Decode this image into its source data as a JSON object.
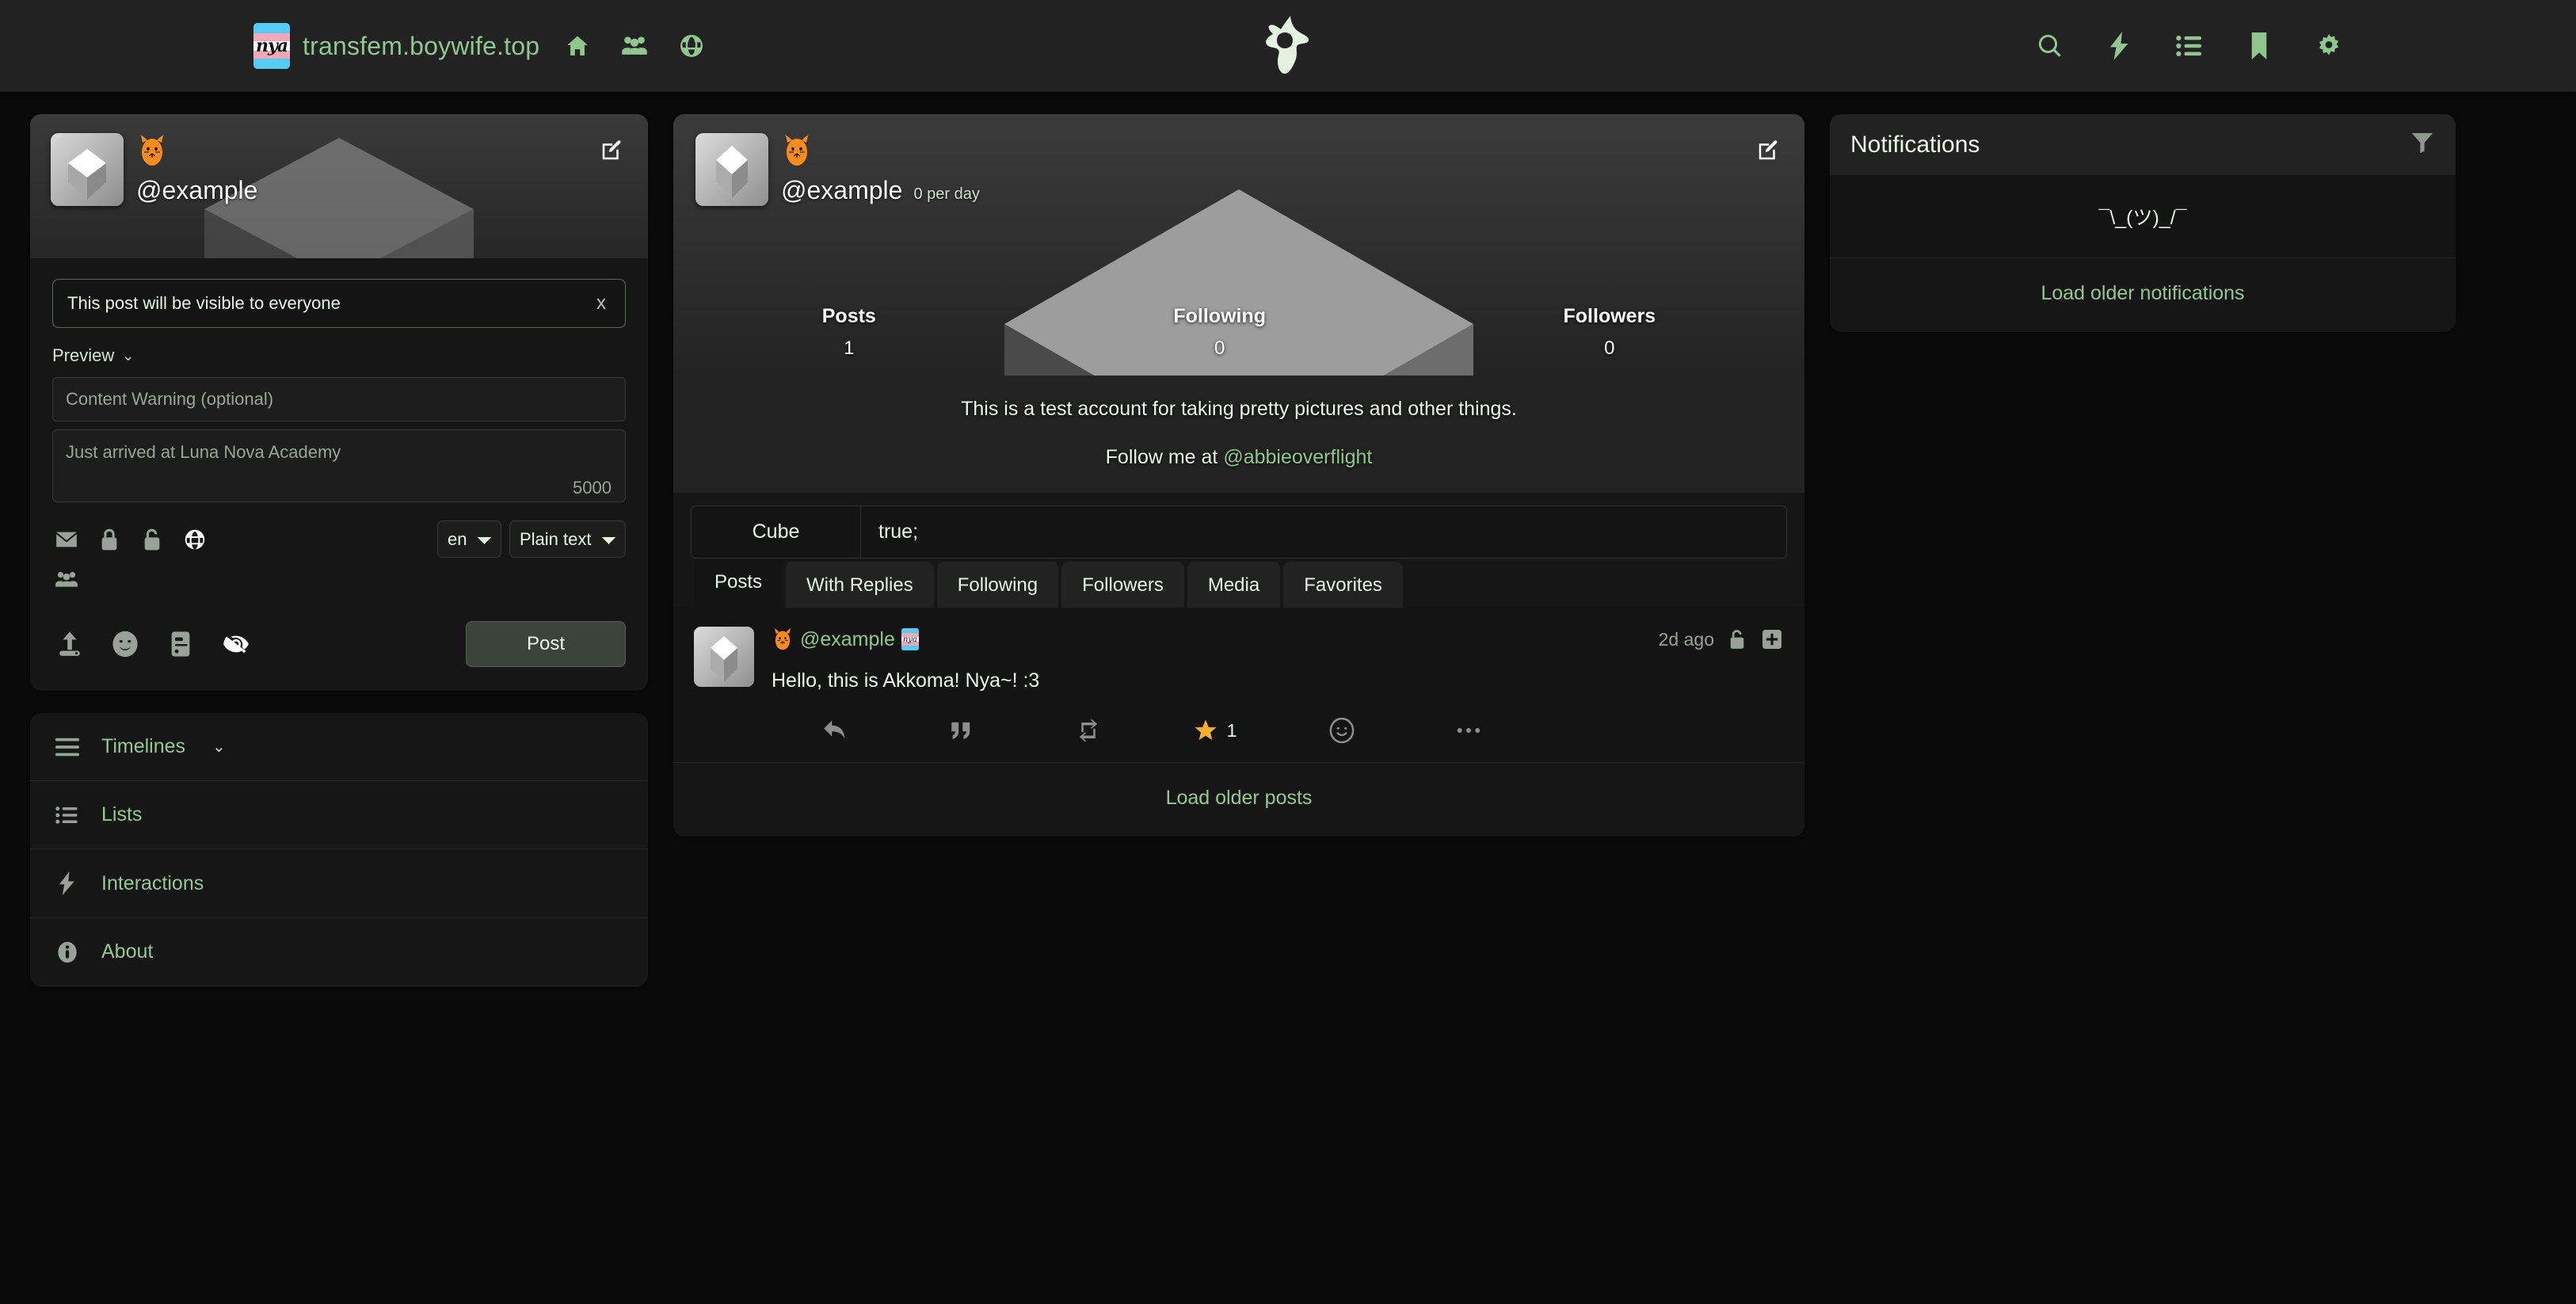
{
  "topbar": {
    "site_name": "transfem.boywife.top",
    "logo_text": "nya",
    "left_icons": [
      {
        "name": "home-icon",
        "label": "Home"
      },
      {
        "name": "users-icon",
        "label": "Local timeline"
      },
      {
        "name": "globe-icon",
        "label": "Federated timeline"
      }
    ],
    "right_icons": [
      {
        "name": "search-icon",
        "label": "Search"
      },
      {
        "name": "bolt-icon",
        "label": "Interactions"
      },
      {
        "name": "list-icon",
        "label": "Lists"
      },
      {
        "name": "bookmark-icon",
        "label": "Bookmarks"
      },
      {
        "name": "gear-icon",
        "label": "Settings"
      }
    ],
    "center_logo": "akkoma-logo"
  },
  "user_panel": {
    "handle": "@example",
    "emoji": "fox-emoji",
    "edit_label": "Edit profile"
  },
  "compose": {
    "visibility_alert": "This post will be visible to everyone",
    "close_label": "x",
    "preview_label": "Preview",
    "cw_placeholder": "Content Warning (optional)",
    "cw_value": "",
    "body_placeholder": "Just arrived at Luna Nova Academy",
    "body_value": "",
    "char_count": "5000",
    "visibility_icons": [
      {
        "name": "envelope-icon",
        "label": "Direct",
        "active": false
      },
      {
        "name": "lock-icon",
        "label": "Followers only",
        "active": false
      },
      {
        "name": "unlock-icon",
        "label": "Unlisted",
        "active": false
      },
      {
        "name": "globe-icon",
        "label": "Public",
        "active": true
      },
      {
        "name": "users-icon",
        "label": "Local only",
        "active": false
      }
    ],
    "language": "en",
    "language_options": [
      "en"
    ],
    "format": "Plain text",
    "format_options": [
      "Plain text"
    ],
    "tools": [
      {
        "name": "upload-icon",
        "label": "Attach media",
        "active": false
      },
      {
        "name": "emoji-icon",
        "label": "Add emoji",
        "active": false
      },
      {
        "name": "poll-icon",
        "label": "Add poll",
        "active": false
      },
      {
        "name": "eye-off-icon",
        "label": "Sensitive media",
        "active": true
      }
    ],
    "post_button": "Post"
  },
  "sidebar_nav": [
    {
      "name": "timelines",
      "label": "Timelines",
      "icon": "hamburger-icon",
      "has_chevron": true
    },
    {
      "name": "lists",
      "label": "Lists",
      "icon": "list-icon",
      "has_chevron": false
    },
    {
      "name": "interactions",
      "label": "Interactions",
      "icon": "bolt-icon",
      "has_chevron": false
    },
    {
      "name": "about",
      "label": "About",
      "icon": "info-icon",
      "has_chevron": false
    }
  ],
  "profile": {
    "handle": "@example",
    "per_day": "0 per day",
    "edit_label": "Edit profile",
    "stats": [
      {
        "label": "Posts",
        "value": "1"
      },
      {
        "label": "Following",
        "value": "0"
      },
      {
        "label": "Followers",
        "value": "0"
      }
    ],
    "bio": "This is a test account for taking pretty pictures and other things.",
    "follow_prefix": "Follow me at ",
    "follow_handle": "@abbieoverflight",
    "fields": [
      {
        "name": "Cube",
        "value": "true;"
      }
    ],
    "tabs": [
      {
        "label": "Posts",
        "active": true
      },
      {
        "label": "With Replies",
        "active": false
      },
      {
        "label": "Following",
        "active": false
      },
      {
        "label": "Followers",
        "active": false
      },
      {
        "label": "Media",
        "active": false
      },
      {
        "label": "Favorites",
        "active": false
      }
    ]
  },
  "post": {
    "handle": "@example",
    "time": "2d ago",
    "text": "Hello, this is Akkoma! Nya~! :3",
    "visibility_icon": "unlock-icon",
    "expand_icon": "plus-icon",
    "actions": [
      {
        "name": "reply-icon",
        "count": ""
      },
      {
        "name": "quote-icon",
        "count": ""
      },
      {
        "name": "repeat-icon",
        "count": ""
      },
      {
        "name": "favorite-icon",
        "count": "1"
      },
      {
        "name": "react-emoji-icon",
        "count": ""
      },
      {
        "name": "more-icon",
        "count": ""
      }
    ],
    "load_older": "Load older posts"
  },
  "notifications": {
    "title": "Notifications",
    "filter_icon": "filter-icon",
    "empty_text": "¯\\_(ツ)_/¯",
    "load_older": "Load older notifications"
  },
  "colors": {
    "accent_green": "#8fc78f",
    "page_bg": "#0a0a0a",
    "card_bg": "#161616",
    "topbar_bg": "#222222",
    "star_gold": "#ffb02e"
  }
}
